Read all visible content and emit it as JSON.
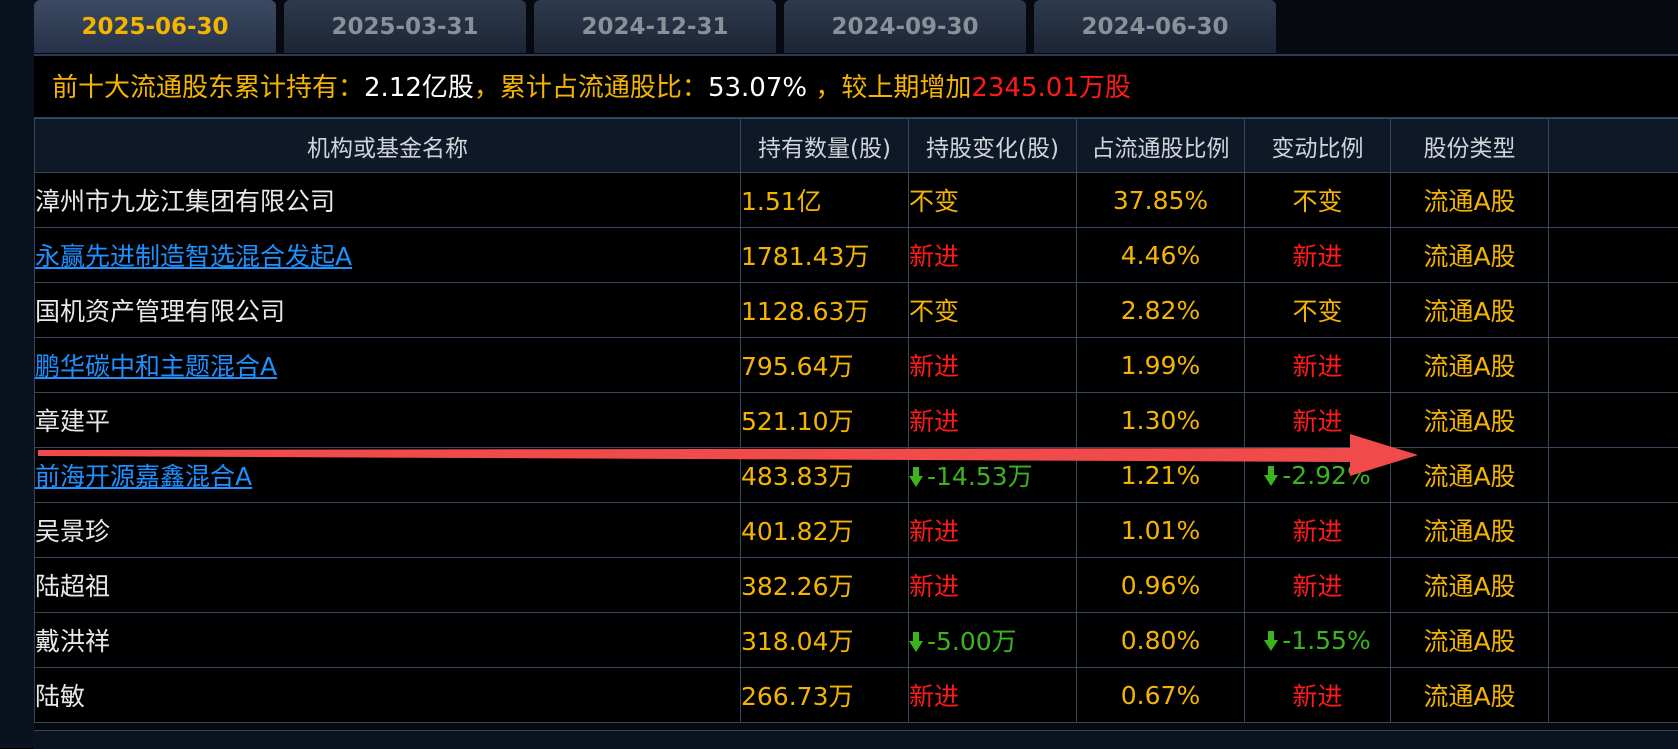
{
  "tabs": [
    {
      "label": "2025-06-30",
      "active": true
    },
    {
      "label": "2025-03-31",
      "active": false
    },
    {
      "label": "2024-12-31",
      "active": false
    },
    {
      "label": "2024-09-30",
      "active": false
    },
    {
      "label": "2024-06-30",
      "active": false
    }
  ],
  "summary": {
    "label_hold": "前十大流通股东累计持有：",
    "hold_value": "2.12亿股",
    "label_ratio": "，累计占流通股比：",
    "ratio_value": "53.07%",
    "label_change": " ，较上期增加",
    "change_value": "2345.01万股"
  },
  "table": {
    "headers": [
      "机构或基金名称",
      "持有数量(股)",
      "持股变化(股)",
      "占流通股比例",
      "变动比例",
      "股份类型"
    ],
    "rows": [
      {
        "name": "漳州市九龙江集团有限公司",
        "link": false,
        "qty": "1.51亿",
        "change": "不变",
        "change_kind": "same",
        "pct": "37.85%",
        "ratio": "不变",
        "ratio_kind": "same",
        "type": "流通A股"
      },
      {
        "name": "永赢先进制造智选混合发起A",
        "link": true,
        "qty": "1781.43万",
        "change": "新进",
        "change_kind": "new",
        "pct": "4.46%",
        "ratio": "新进",
        "ratio_kind": "new",
        "type": "流通A股"
      },
      {
        "name": "国机资产管理有限公司",
        "link": false,
        "qty": "1128.63万",
        "change": "不变",
        "change_kind": "same",
        "pct": "2.82%",
        "ratio": "不变",
        "ratio_kind": "same",
        "type": "流通A股"
      },
      {
        "name": "鹏华碳中和主题混合A",
        "link": true,
        "qty": "795.64万",
        "change": "新进",
        "change_kind": "new",
        "pct": "1.99%",
        "ratio": "新进",
        "ratio_kind": "new",
        "type": "流通A股"
      },
      {
        "name": "章建平",
        "link": false,
        "qty": "521.10万",
        "change": "新进",
        "change_kind": "new",
        "pct": "1.30%",
        "ratio": "新进",
        "ratio_kind": "new",
        "type": "流通A股"
      },
      {
        "name": "前海开源嘉鑫混合A",
        "link": true,
        "qty": "483.83万",
        "change": "-14.53万",
        "change_kind": "down",
        "pct": "1.21%",
        "ratio": "-2.92%",
        "ratio_kind": "down",
        "type": "流通A股"
      },
      {
        "name": "吴景珍",
        "link": false,
        "qty": "401.82万",
        "change": "新进",
        "change_kind": "new",
        "pct": "1.01%",
        "ratio": "新进",
        "ratio_kind": "new",
        "type": "流通A股"
      },
      {
        "name": "陆超祖",
        "link": false,
        "qty": "382.26万",
        "change": "新进",
        "change_kind": "new",
        "pct": "0.96%",
        "ratio": "新进",
        "ratio_kind": "new",
        "type": "流通A股"
      },
      {
        "name": "戴洪祥",
        "link": false,
        "qty": "318.04万",
        "change": "-5.00万",
        "change_kind": "down",
        "pct": "0.80%",
        "ratio": "-1.55%",
        "ratio_kind": "down",
        "type": "流通A股"
      },
      {
        "name": "陆敏",
        "link": false,
        "qty": "266.73万",
        "change": "新进",
        "change_kind": "new",
        "pct": "0.67%",
        "ratio": "新进",
        "ratio_kind": "new",
        "type": "流通A股"
      }
    ]
  },
  "icons": {
    "down_arrow": "arrow-down-icon",
    "annotation": "red-annotation-arrow"
  },
  "colors": {
    "accent_gold": "#f5b400",
    "new_red": "#ff1a1a",
    "down_green": "#3cb41e",
    "link_blue": "#1e90ff",
    "annotation_red": "#f04a4a"
  }
}
